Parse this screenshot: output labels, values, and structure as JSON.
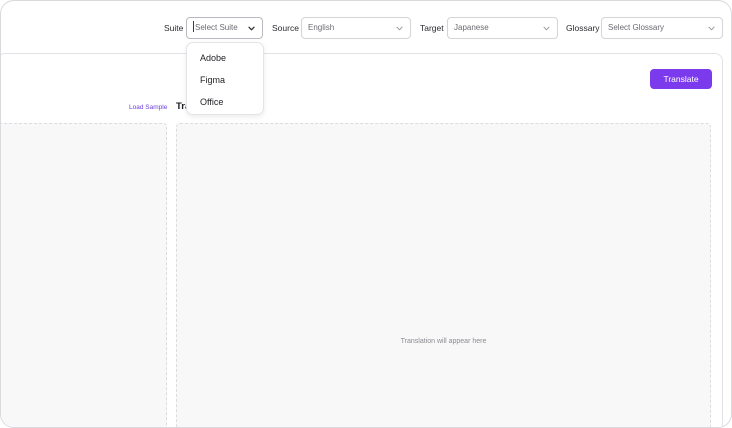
{
  "toolbar": {
    "suite": {
      "label": "Suite",
      "placeholder": "Select Suite"
    },
    "source": {
      "label": "Source",
      "value": "English"
    },
    "target": {
      "label": "Target",
      "value": "Japanese"
    },
    "glossary": {
      "label": "Glossary",
      "placeholder": "Select Glossary"
    },
    "chevron_icon": "chevron-down-icon"
  },
  "suite_dropdown": {
    "options": [
      "Adobe",
      "Figma",
      "Office"
    ]
  },
  "main": {
    "translate_label": "Translate",
    "load_sample_label": "Load Sample",
    "translation_title": "Tra",
    "translation_placeholder": "Translation will appear here"
  },
  "colors": {
    "accent": "#7c3aed",
    "link": "#6d3fe0",
    "panel_bg": "#f8f8f9"
  }
}
